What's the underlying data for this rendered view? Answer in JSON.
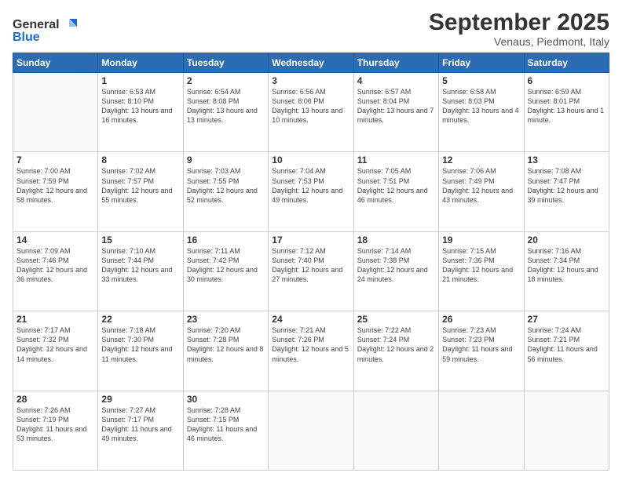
{
  "logo": {
    "line1": "General",
    "line2": "Blue"
  },
  "title": "September 2025",
  "subtitle": "Venaus, Piedmont, Italy",
  "weekdays": [
    "Sunday",
    "Monday",
    "Tuesday",
    "Wednesday",
    "Thursday",
    "Friday",
    "Saturday"
  ],
  "weeks": [
    [
      {
        "day": "",
        "sunrise": "",
        "sunset": "",
        "daylight": ""
      },
      {
        "day": "1",
        "sunrise": "Sunrise: 6:53 AM",
        "sunset": "Sunset: 8:10 PM",
        "daylight": "Daylight: 13 hours and 16 minutes."
      },
      {
        "day": "2",
        "sunrise": "Sunrise: 6:54 AM",
        "sunset": "Sunset: 8:08 PM",
        "daylight": "Daylight: 13 hours and 13 minutes."
      },
      {
        "day": "3",
        "sunrise": "Sunrise: 6:56 AM",
        "sunset": "Sunset: 8:06 PM",
        "daylight": "Daylight: 13 hours and 10 minutes."
      },
      {
        "day": "4",
        "sunrise": "Sunrise: 6:57 AM",
        "sunset": "Sunset: 8:04 PM",
        "daylight": "Daylight: 13 hours and 7 minutes."
      },
      {
        "day": "5",
        "sunrise": "Sunrise: 6:58 AM",
        "sunset": "Sunset: 8:03 PM",
        "daylight": "Daylight: 13 hours and 4 minutes."
      },
      {
        "day": "6",
        "sunrise": "Sunrise: 6:59 AM",
        "sunset": "Sunset: 8:01 PM",
        "daylight": "Daylight: 13 hours and 1 minute."
      }
    ],
    [
      {
        "day": "7",
        "sunrise": "Sunrise: 7:00 AM",
        "sunset": "Sunset: 7:59 PM",
        "daylight": "Daylight: 12 hours and 58 minutes."
      },
      {
        "day": "8",
        "sunrise": "Sunrise: 7:02 AM",
        "sunset": "Sunset: 7:57 PM",
        "daylight": "Daylight: 12 hours and 55 minutes."
      },
      {
        "day": "9",
        "sunrise": "Sunrise: 7:03 AM",
        "sunset": "Sunset: 7:55 PM",
        "daylight": "Daylight: 12 hours and 52 minutes."
      },
      {
        "day": "10",
        "sunrise": "Sunrise: 7:04 AM",
        "sunset": "Sunset: 7:53 PM",
        "daylight": "Daylight: 12 hours and 49 minutes."
      },
      {
        "day": "11",
        "sunrise": "Sunrise: 7:05 AM",
        "sunset": "Sunset: 7:51 PM",
        "daylight": "Daylight: 12 hours and 46 minutes."
      },
      {
        "day": "12",
        "sunrise": "Sunrise: 7:06 AM",
        "sunset": "Sunset: 7:49 PM",
        "daylight": "Daylight: 12 hours and 43 minutes."
      },
      {
        "day": "13",
        "sunrise": "Sunrise: 7:08 AM",
        "sunset": "Sunset: 7:47 PM",
        "daylight": "Daylight: 12 hours and 39 minutes."
      }
    ],
    [
      {
        "day": "14",
        "sunrise": "Sunrise: 7:09 AM",
        "sunset": "Sunset: 7:46 PM",
        "daylight": "Daylight: 12 hours and 36 minutes."
      },
      {
        "day": "15",
        "sunrise": "Sunrise: 7:10 AM",
        "sunset": "Sunset: 7:44 PM",
        "daylight": "Daylight: 12 hours and 33 minutes."
      },
      {
        "day": "16",
        "sunrise": "Sunrise: 7:11 AM",
        "sunset": "Sunset: 7:42 PM",
        "daylight": "Daylight: 12 hours and 30 minutes."
      },
      {
        "day": "17",
        "sunrise": "Sunrise: 7:12 AM",
        "sunset": "Sunset: 7:40 PM",
        "daylight": "Daylight: 12 hours and 27 minutes."
      },
      {
        "day": "18",
        "sunrise": "Sunrise: 7:14 AM",
        "sunset": "Sunset: 7:38 PM",
        "daylight": "Daylight: 12 hours and 24 minutes."
      },
      {
        "day": "19",
        "sunrise": "Sunrise: 7:15 AM",
        "sunset": "Sunset: 7:36 PM",
        "daylight": "Daylight: 12 hours and 21 minutes."
      },
      {
        "day": "20",
        "sunrise": "Sunrise: 7:16 AM",
        "sunset": "Sunset: 7:34 PM",
        "daylight": "Daylight: 12 hours and 18 minutes."
      }
    ],
    [
      {
        "day": "21",
        "sunrise": "Sunrise: 7:17 AM",
        "sunset": "Sunset: 7:32 PM",
        "daylight": "Daylight: 12 hours and 14 minutes."
      },
      {
        "day": "22",
        "sunrise": "Sunrise: 7:18 AM",
        "sunset": "Sunset: 7:30 PM",
        "daylight": "Daylight: 12 hours and 11 minutes."
      },
      {
        "day": "23",
        "sunrise": "Sunrise: 7:20 AM",
        "sunset": "Sunset: 7:28 PM",
        "daylight": "Daylight: 12 hours and 8 minutes."
      },
      {
        "day": "24",
        "sunrise": "Sunrise: 7:21 AM",
        "sunset": "Sunset: 7:26 PM",
        "daylight": "Daylight: 12 hours and 5 minutes."
      },
      {
        "day": "25",
        "sunrise": "Sunrise: 7:22 AM",
        "sunset": "Sunset: 7:24 PM",
        "daylight": "Daylight: 12 hours and 2 minutes."
      },
      {
        "day": "26",
        "sunrise": "Sunrise: 7:23 AM",
        "sunset": "Sunset: 7:23 PM",
        "daylight": "Daylight: 11 hours and 59 minutes."
      },
      {
        "day": "27",
        "sunrise": "Sunrise: 7:24 AM",
        "sunset": "Sunset: 7:21 PM",
        "daylight": "Daylight: 11 hours and 56 minutes."
      }
    ],
    [
      {
        "day": "28",
        "sunrise": "Sunrise: 7:26 AM",
        "sunset": "Sunset: 7:19 PM",
        "daylight": "Daylight: 11 hours and 53 minutes."
      },
      {
        "day": "29",
        "sunrise": "Sunrise: 7:27 AM",
        "sunset": "Sunset: 7:17 PM",
        "daylight": "Daylight: 11 hours and 49 minutes."
      },
      {
        "day": "30",
        "sunrise": "Sunrise: 7:28 AM",
        "sunset": "Sunset: 7:15 PM",
        "daylight": "Daylight: 11 hours and 46 minutes."
      },
      {
        "day": "",
        "sunrise": "",
        "sunset": "",
        "daylight": ""
      },
      {
        "day": "",
        "sunrise": "",
        "sunset": "",
        "daylight": ""
      },
      {
        "day": "",
        "sunrise": "",
        "sunset": "",
        "daylight": ""
      },
      {
        "day": "",
        "sunrise": "",
        "sunset": "",
        "daylight": ""
      }
    ]
  ]
}
